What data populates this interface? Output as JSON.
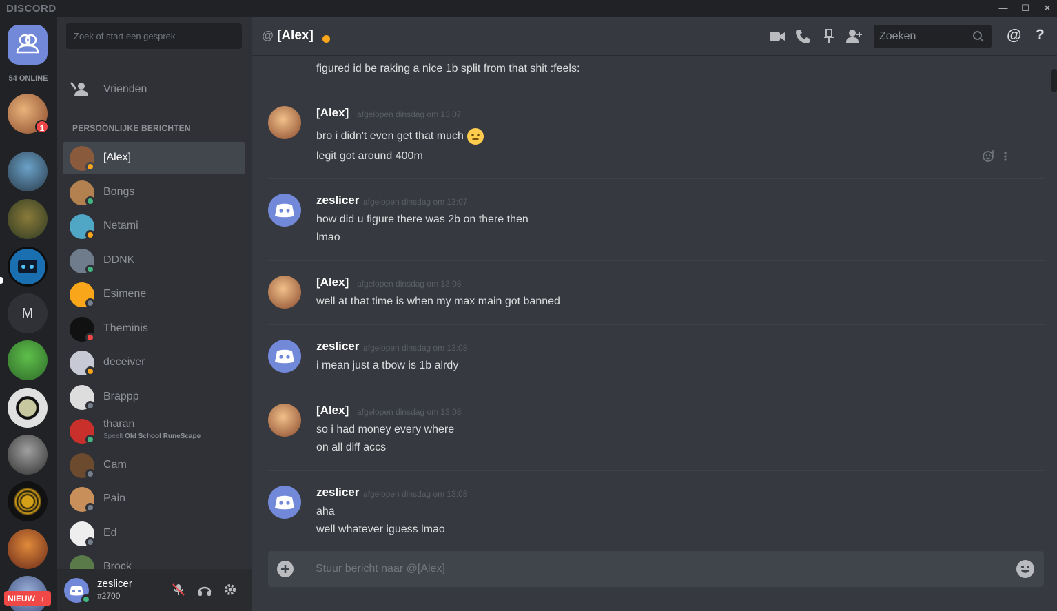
{
  "titlebar": {
    "logo": "DISCORD",
    "minimize": "—",
    "maximize": "☐",
    "close": "✕"
  },
  "rail": {
    "online": "54 ONLINE",
    "badge_count": "1",
    "m_server": "M",
    "new_label": "NIEUW",
    "new_arrow": "↓"
  },
  "sidebar": {
    "search_placeholder": "Zoek of start een gesprek",
    "friends_label": "Vrienden",
    "section_title": "PERSOONLIJKE BERICHTEN",
    "dms": [
      {
        "name": "[Alex]",
        "status": "#faa61a",
        "avatar": "#8a5a3c"
      },
      {
        "name": "Bongs",
        "status": "#43b581",
        "avatar": "#b3814f"
      },
      {
        "name": "Netami",
        "status": "#faa61a",
        "avatar": "#4fa6c5"
      },
      {
        "name": "DDNK",
        "status": "#43b581",
        "avatar": "#6f7c8c"
      },
      {
        "name": "Esimene",
        "status": "#747f8d",
        "avatar": "#faa61a"
      },
      {
        "name": "Theminis",
        "status": "#f04747",
        "avatar": "#111111"
      },
      {
        "name": "deceiver",
        "status": "#faa61a",
        "avatar": "#c7c9d4"
      },
      {
        "name": "Brappp",
        "status": "#747f8d",
        "avatar": "#dddddd"
      },
      {
        "name": "tharan",
        "status": "#43b581",
        "avatar": "#c9302c",
        "sub_prefix": "Speelt",
        "sub_game": "Old School RuneScape"
      },
      {
        "name": "Cam",
        "status": "#747f8d",
        "avatar": "#6b4a2e"
      },
      {
        "name": "Pain",
        "status": "#747f8d",
        "avatar": "#c98f5a"
      },
      {
        "name": "Ed",
        "status": "#747f8d",
        "avatar": "#eeeeee"
      },
      {
        "name": "Brock",
        "status": "#747f8d",
        "avatar": "#5a7a4a"
      }
    ]
  },
  "user_panel": {
    "name": "zeslicer",
    "tag": "#2700",
    "status_color": "#43b581"
  },
  "header": {
    "at": "@",
    "title": "[Alex]",
    "search_placeholder": "Zoeken",
    "at_button": "@",
    "help": "?"
  },
  "messages": {
    "partial_top": "figured id be raking a nice 1b split from that shit :feels:",
    "groups": [
      {
        "author": "[Alex]",
        "time": "afgelopen dinsdag om 13:07",
        "lines": [
          "bro i didn't even get that much",
          "legit got around 400m"
        ]
      },
      {
        "author": "zeslicer",
        "time": "afgelopen dinsdag om 13:07",
        "lines": [
          "how did u figure there was 2b on there then",
          "lmao"
        ]
      },
      {
        "author": "[Alex]",
        "time": "afgelopen dinsdag om 13:08",
        "lines": [
          "well at that time is when my max main got banned"
        ]
      },
      {
        "author": "zeslicer",
        "time": "afgelopen dinsdag om 13:08",
        "lines": [
          "i mean just a tbow is 1b alrdy"
        ]
      },
      {
        "author": "[Alex]",
        "time": "afgelopen dinsdag om 13:08",
        "lines": [
          "so i had money every where",
          "on all diff accs"
        ]
      },
      {
        "author": "zeslicer",
        "time": "afgelopen dinsdag om 13:08",
        "lines": [
          "aha",
          "well whatever iguess lmao"
        ]
      }
    ]
  },
  "composer": {
    "placeholder": "Stuur bericht naar @[Alex]"
  },
  "colors": {
    "accent": "#7289da",
    "online": "#43b581",
    "idle": "#faa61a",
    "dnd": "#f04747",
    "offline": "#747f8d"
  }
}
